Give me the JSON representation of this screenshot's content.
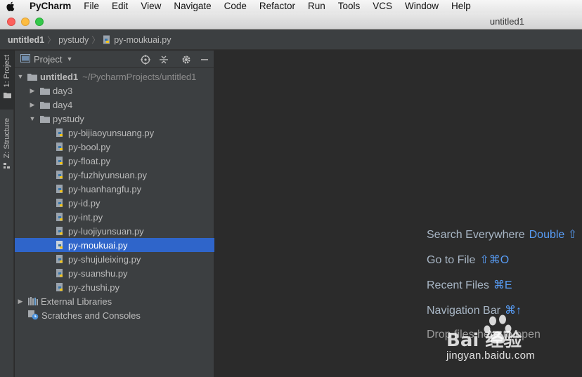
{
  "menubar": {
    "app_name": "PyCharm",
    "items": [
      "File",
      "Edit",
      "View",
      "Navigate",
      "Code",
      "Refactor",
      "Run",
      "Tools",
      "VCS",
      "Window",
      "Help"
    ]
  },
  "window": {
    "title": "untitled1"
  },
  "breadcrumb": [
    "untitled1",
    "pystudy",
    "py-moukuai.py"
  ],
  "tool_strip": {
    "project_tab": "1: Project",
    "structure_tab": "Z: Structure"
  },
  "project_panel": {
    "title": "Project",
    "root": {
      "name": "untitled1",
      "path": "~/PycharmProjects/untitled1"
    },
    "folders": [
      "day3",
      "day4",
      "pystudy"
    ],
    "files": [
      "py-bijiaoyunsuang.py",
      "py-bool.py",
      "py-float.py",
      "py-fuzhiyunsuan.py",
      "py-huanhangfu.py",
      "py-id.py",
      "py-int.py",
      "py-luojiyunsuan.py",
      "py-moukuai.py",
      "py-shujuleixing.py",
      "py-suanshu.py",
      "py-zhushi.py"
    ],
    "selected_file": "py-moukuai.py",
    "external_libraries": "External Libraries",
    "scratches": "Scratches and Consoles"
  },
  "editor_hints": [
    {
      "label": "Search Everywhere",
      "shortcut": "Double ⇧"
    },
    {
      "label": "Go to File",
      "shortcut": "⇧⌘O"
    },
    {
      "label": "Recent Files",
      "shortcut": "⌘E"
    },
    {
      "label": "Navigation Bar",
      "shortcut": "⌘↑"
    },
    {
      "label": "Drop files here to open",
      "shortcut": ""
    }
  ],
  "watermark": {
    "brand": "Bai 经验",
    "url": "jingyan.baidu.com"
  },
  "colors": {
    "selection": "#2f65ca",
    "shortcut": "#589df6",
    "panel_bg": "#3c3f41",
    "editor_bg": "#2b2b2b"
  }
}
